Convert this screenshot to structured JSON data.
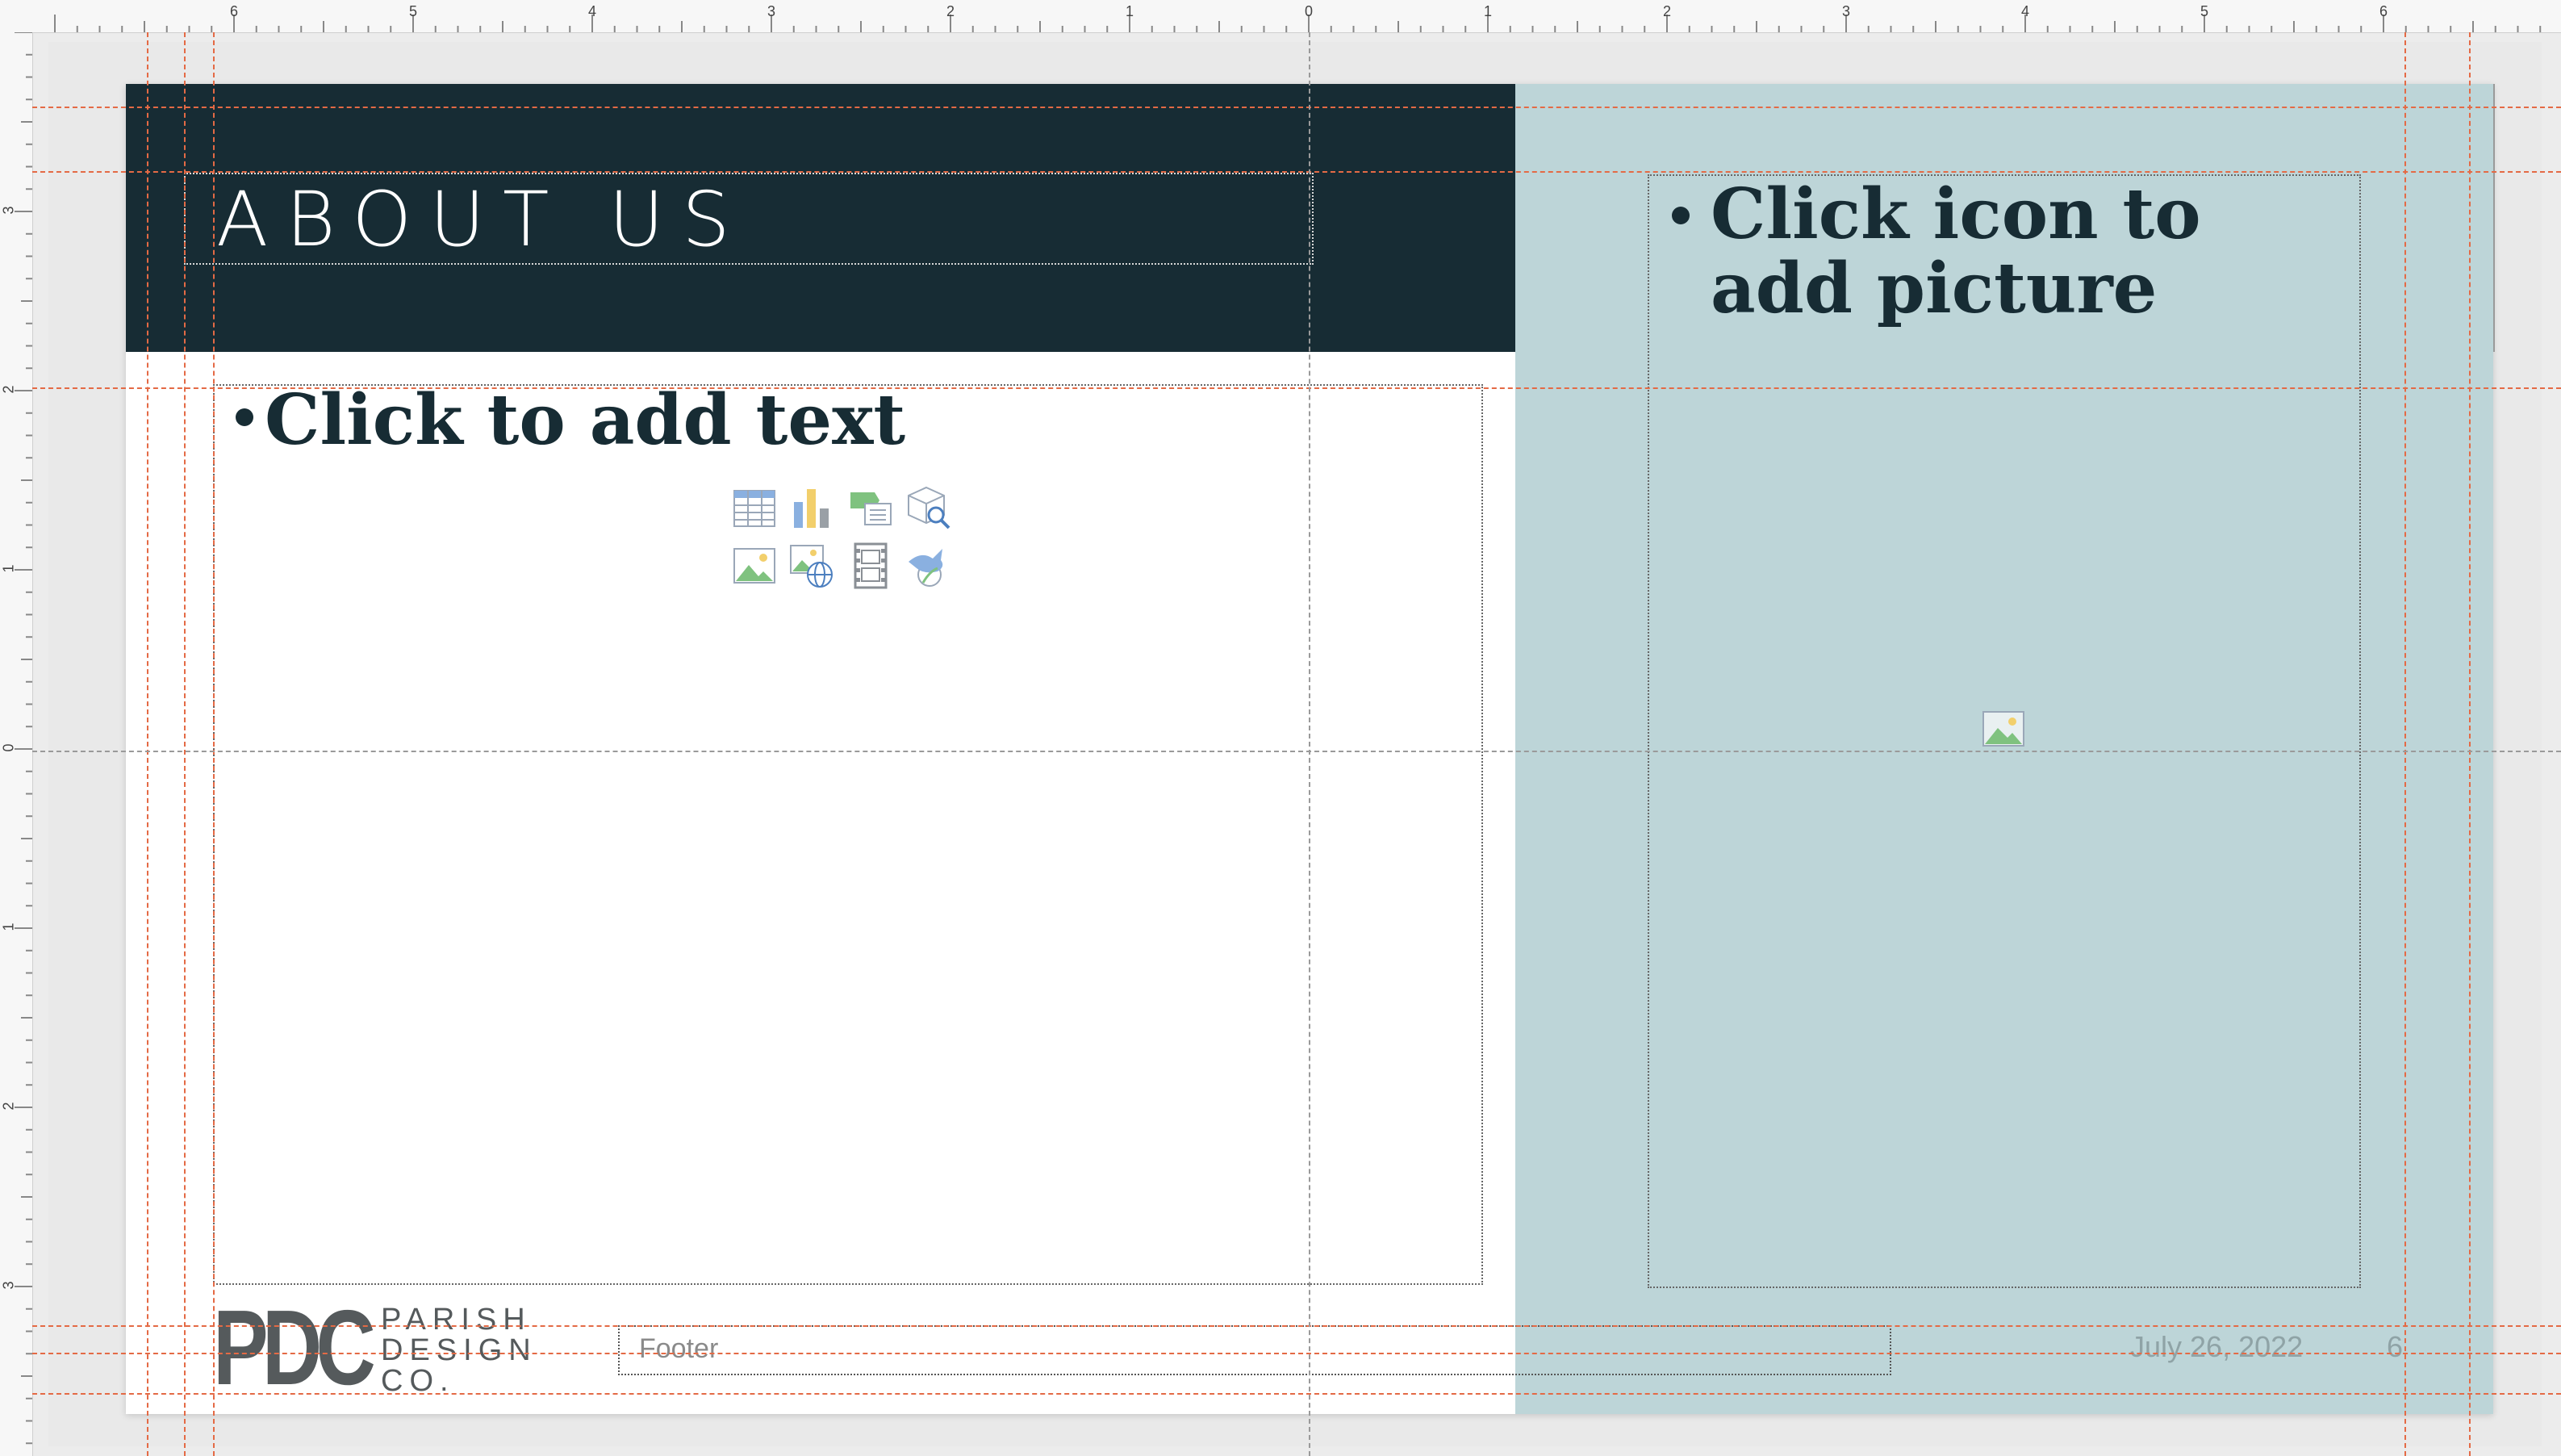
{
  "ruler": {
    "top_labels": [
      "6",
      "5",
      "4",
      "3",
      "2",
      "1",
      "0",
      "1",
      "2",
      "3",
      "4",
      "5",
      "6"
    ],
    "left_labels": [
      "3",
      "2",
      "1",
      "0",
      "1",
      "2",
      "3"
    ]
  },
  "slide": {
    "title": "ABOUT US",
    "body_placeholder": "Click to add text",
    "picture_placeholder": "Click icon to add picture",
    "footer": "Footer",
    "date": "July 26, 2022",
    "page_number": "6",
    "logo": {
      "monogram": "PDC",
      "words": [
        "PARISH",
        "DESIGN",
        "CO."
      ]
    }
  },
  "colors": {
    "header_band": "#172c34",
    "picture_panel": "#bdd5d8",
    "guides": "#e46a45",
    "title_text": "#ffffff",
    "body_text": "#172c34"
  },
  "insert_icons": [
    "table-icon",
    "chart-icon",
    "smartart-icon",
    "3d-model-icon",
    "picture-icon",
    "online-picture-icon",
    "video-icon",
    "icons-icon"
  ]
}
